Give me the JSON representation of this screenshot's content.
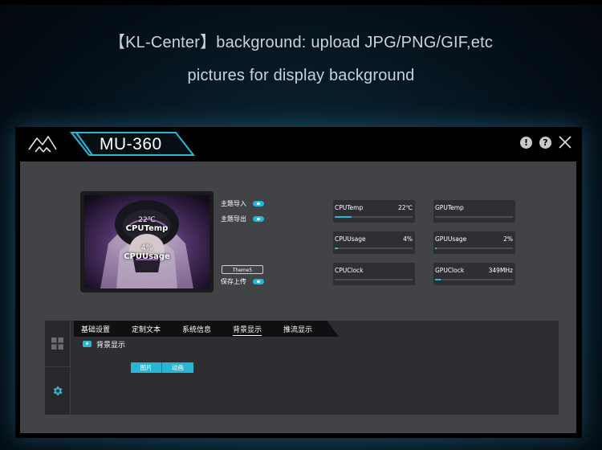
{
  "headline": {
    "line1": "【KL-Center】background: upload JPG/PNG/GIF,etc",
    "line2": "pictures for display background"
  },
  "window": {
    "title": "MU-360",
    "buttons": {
      "info": "!",
      "help": "?"
    }
  },
  "preview": {
    "temp_value": "22℃",
    "temp_label": "CPUTemp",
    "usage_value": "4%",
    "usage_label": "CPUUsage"
  },
  "theme_options": {
    "import_label": "主题导入",
    "export_label": "主题导出",
    "theme_name": "Theme5",
    "save_upload_label": "保存上传"
  },
  "metrics": [
    {
      "name": "CPUTemp",
      "value": "22℃",
      "fill": 0.22
    },
    {
      "name": "GPUTemp",
      "value": "",
      "fill": 0
    },
    {
      "name": "CPUUsage",
      "value": "4%",
      "fill": 0.04
    },
    {
      "name": "GPUUsage",
      "value": "2%",
      "fill": 0.02
    },
    {
      "name": "CPUClock",
      "value": "",
      "fill": 0
    },
    {
      "name": "GPUClock",
      "value": "349MHz",
      "fill": 0.07
    }
  ],
  "tabs": [
    {
      "label": "基础设置"
    },
    {
      "label": "定制文本"
    },
    {
      "label": "系统信息"
    },
    {
      "label": "背景显示",
      "active": true
    },
    {
      "label": "推流显示"
    }
  ],
  "section": {
    "title": "背景显示",
    "buttons": [
      "图片",
      "动画"
    ]
  },
  "colors": {
    "accent": "#2bb6d6",
    "window_bg": "#000000",
    "content_bg": "#424346",
    "panel_bg": "#2d2e31"
  },
  "icons": {
    "logo": "kl-logo-icon",
    "info": "info-icon",
    "help": "help-icon",
    "close": "close-icon",
    "grid": "grid-icon",
    "settings": "gear-icon"
  }
}
